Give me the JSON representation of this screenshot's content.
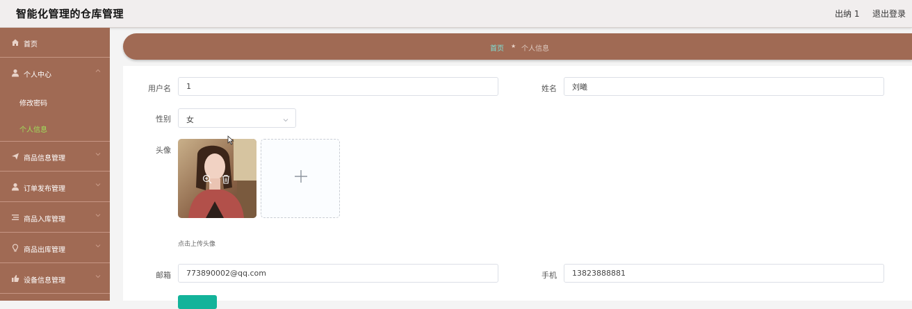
{
  "header": {
    "title": "智能化管理的仓库管理",
    "user": "出纳 1",
    "logout": "退出登录"
  },
  "sidebar": {
    "items": [
      {
        "label": "首页",
        "icon": "home-icon"
      },
      {
        "label": "个人中心",
        "icon": "user-icon"
      },
      {
        "label": "商品信息管理",
        "icon": "send-icon"
      },
      {
        "label": "订单发布管理",
        "icon": "user-icon"
      },
      {
        "label": "商品入库管理",
        "icon": "list-icon"
      },
      {
        "label": "商品出库管理",
        "icon": "bulb-icon"
      },
      {
        "label": "设备信息管理",
        "icon": "thumb-icon"
      }
    ],
    "subitems": [
      {
        "label": "修改密码"
      },
      {
        "label": "个人信息"
      }
    ]
  },
  "breadcrumb": {
    "home": "首页",
    "current": "个人信息"
  },
  "form": {
    "username_label": "用户名",
    "username_value": "1",
    "name_label": "姓名",
    "name_value": "刘曦",
    "gender_label": "性别",
    "gender_value": "女",
    "avatar_label": "头像",
    "avatar_tip": "点击上传头像",
    "email_label": "邮箱",
    "email_value": "773890002@qq.com",
    "phone_label": "手机",
    "phone_value": "13823888881"
  },
  "colors": {
    "brand": "#a06a54",
    "active_menu": "#9fe05a",
    "breadcrumb_home": "#7fe0d6",
    "submit": "#13b39a"
  }
}
